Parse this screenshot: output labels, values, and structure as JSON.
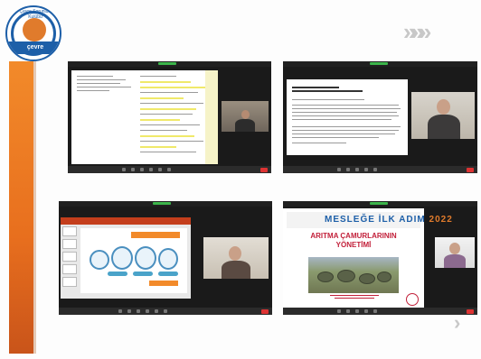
{
  "logo": {
    "top_text": "Çevre Sorunları Kulübü",
    "band_text": "çevre mühendisliği"
  },
  "nav": {
    "chevrons": "»»»",
    "next_arrow": "›"
  },
  "poster": {
    "brand_part1": "MESLEĞE İLK ADIM",
    "brand_year": "2022",
    "title_line1": "ARITMA ÇAMURLARININ",
    "title_line2": "YÖNETİMİ"
  },
  "colors": {
    "accent_orange": "#f28a2a",
    "brand_blue": "#1d5fa8",
    "poster_red": "#c2203a"
  }
}
